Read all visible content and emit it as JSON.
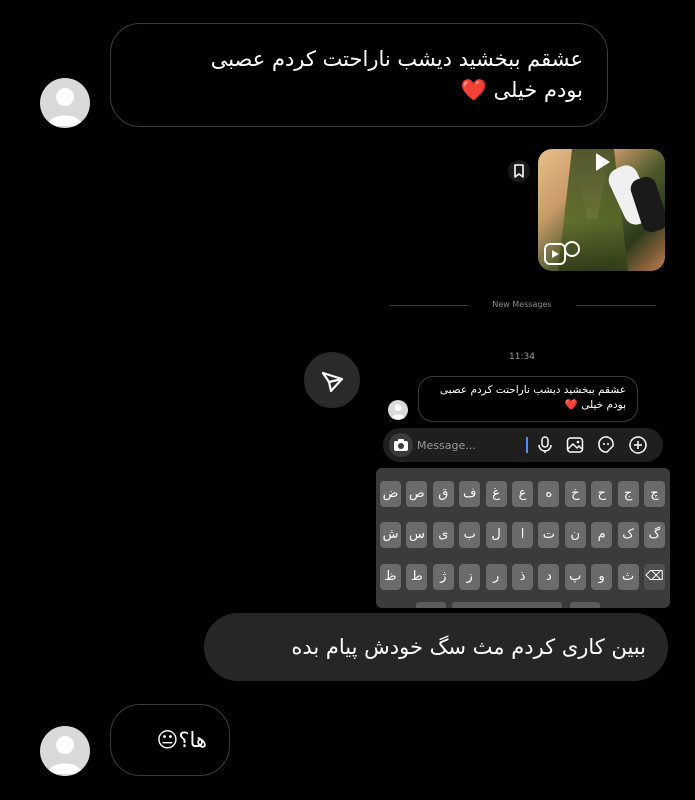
{
  "messages": {
    "first_line1": "عشقم ببخشید دیشب ناراحتت کردم عصبی",
    "first_line2": "بودم خیلی",
    "first_emoji": "❤️",
    "outgoing": "ببین کاری کردم مث سگ خودش پیام بده",
    "last_text": "ها؟",
    "last_emoji": "😐"
  },
  "divider_label": "New Messages",
  "timestamp": "11:34",
  "screenshot_preview": {
    "line1": "عشقم ببخشید دیشب ناراحتت کردم عصبی",
    "line2": "بودم خیلی",
    "emoji": "❤️"
  },
  "composer": {
    "placeholder": "Message..."
  },
  "keyboard": {
    "row1": [
      "چ",
      "ج",
      "ح",
      "خ",
      "ه",
      "ع",
      "غ",
      "ف",
      "ق",
      "ص",
      "ض"
    ],
    "row2": [
      "گ",
      "ک",
      "م",
      "ن",
      "ت",
      "ا",
      "ل",
      "ب",
      "ی",
      "س",
      "ش"
    ],
    "row3": [
      "⌫",
      "ث",
      "و",
      "پ",
      "د",
      "ذ",
      "ر",
      "ز",
      "ژ",
      "ط",
      "ظ"
    ]
  },
  "icons": {
    "share": "send-icon",
    "bookmark": "bookmark-icon",
    "camera": "camera-icon",
    "mic": "microphone-icon",
    "gallery": "image-icon",
    "sticker": "sticker-icon",
    "add": "plus-icon"
  },
  "colors": {
    "background": "#000000",
    "outgoing_bubble": "#262626",
    "incoming_border": "#3a3a3a",
    "caret": "#4a90ff"
  }
}
